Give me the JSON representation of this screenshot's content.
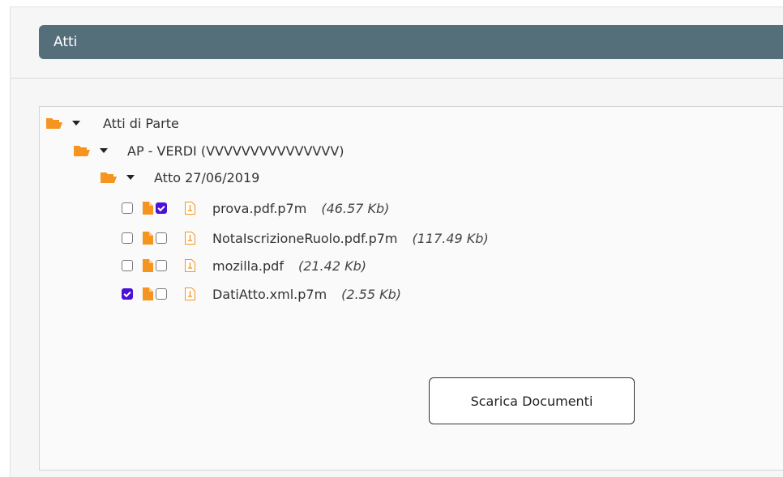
{
  "panel": {
    "title": "Atti"
  },
  "tree": {
    "root": {
      "label": "Atti di Parte",
      "expanded": true,
      "icon": "folder-open-icon",
      "children": [
        {
          "label": "AP - VERDI (VVVVVVVVVVVVVVV)",
          "expanded": true,
          "icon": "folder-open-icon",
          "children": [
            {
              "label": "Atto 27/06/2019",
              "expanded": true,
              "icon": "folder-open-icon",
              "files": [
                {
                  "select_checked": false,
                  "flag_checked": true,
                  "name": "prova.pdf.p7m",
                  "size": "(46.57 Kb)"
                },
                {
                  "select_checked": false,
                  "flag_checked": false,
                  "name": "NotaIscrizioneRuolo.pdf.p7m",
                  "size": "(117.49 Kb)"
                },
                {
                  "select_checked": false,
                  "flag_checked": false,
                  "name": "mozilla.pdf",
                  "size": "(21.42 Kb)"
                },
                {
                  "select_checked": true,
                  "flag_checked": false,
                  "name": "DatiAtto.xml.p7m",
                  "size": "(2.55 Kb)"
                }
              ]
            }
          ]
        }
      ]
    }
  },
  "actions": {
    "download_label": "Scarica Documenti"
  },
  "colors": {
    "header_bg": "#546e7a",
    "folder": "#f5941f",
    "checkbox_checked": "#4a12d6"
  }
}
